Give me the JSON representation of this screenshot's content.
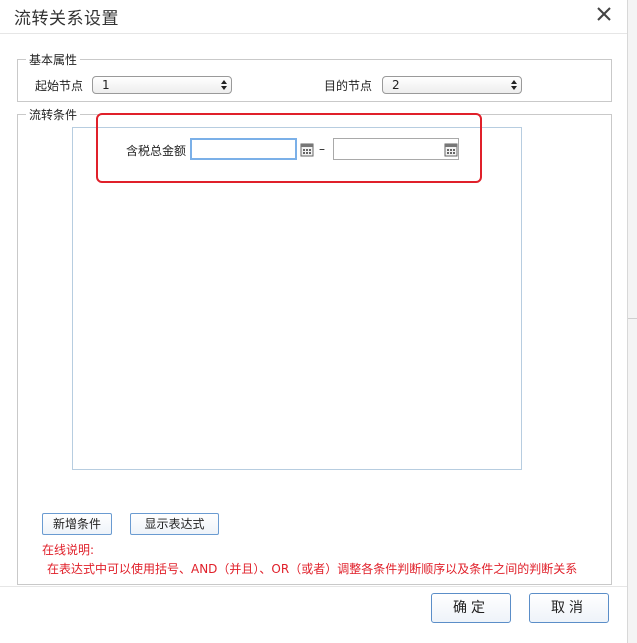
{
  "dialog": {
    "title": "流转关系设置",
    "close_icon": "close-icon"
  },
  "basic": {
    "legend": "基本属性",
    "start_label": "起始节点",
    "start_value": "1",
    "target_label": "目的节点",
    "target_value": "2"
  },
  "condition": {
    "legend": "流转条件",
    "field_label": "含税总金额",
    "from_value": "",
    "to_value": "",
    "separator": "–",
    "calendar_icon": "calendar-icon"
  },
  "actions": {
    "add_condition": "新增条件",
    "show_expression": "显示表达式"
  },
  "notes": {
    "heading": "在线说明:",
    "text": "在表达式中可以使用括号、AND（并且）、OR（或者）调整各条件判断顺序以及条件之间的判断关系"
  },
  "footer": {
    "ok": "确定",
    "cancel": "取消"
  },
  "colors": {
    "highlight": "#e0202a",
    "button_border": "#5b8ec8",
    "focus_border": "#7bb0e8"
  }
}
